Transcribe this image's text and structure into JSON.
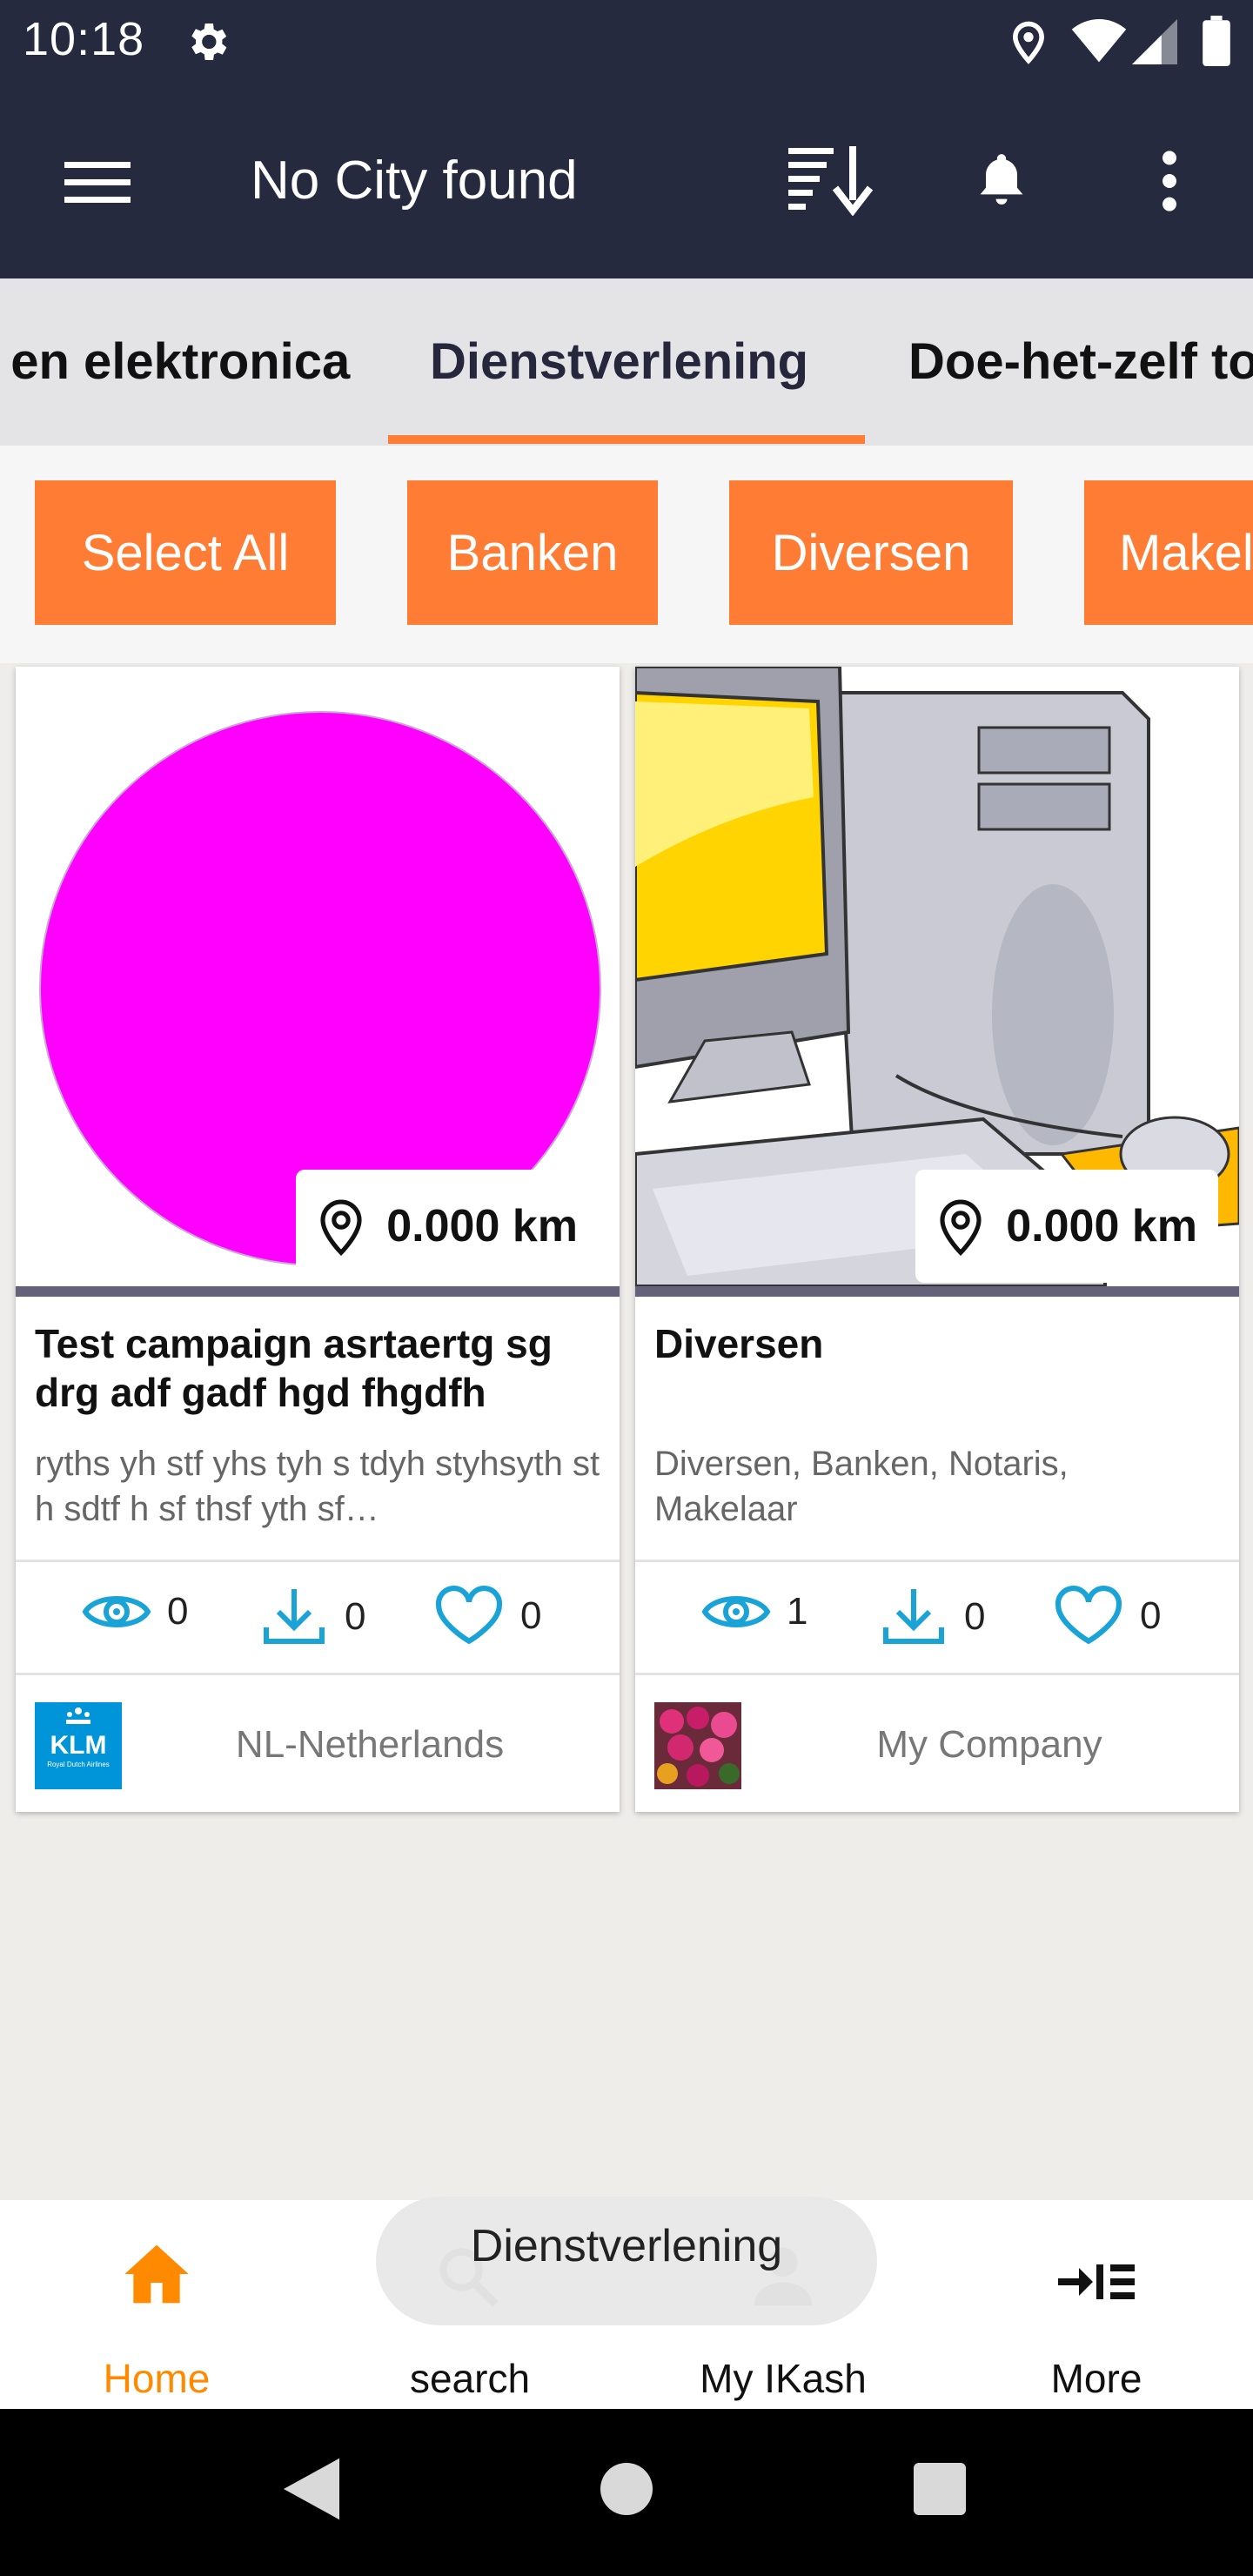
{
  "status_bar": {
    "time": "10:18"
  },
  "toolbar": {
    "title": "No City found"
  },
  "tabs": [
    {
      "label": "Computers en elektronica",
      "active": false
    },
    {
      "label": "Dienstverlening",
      "active": true
    },
    {
      "label": "Doe-het-zelf tools",
      "active": false
    }
  ],
  "chips": [
    "Select All",
    "Banken",
    "Diversen",
    "Makelaar"
  ],
  "cards": [
    {
      "distance": "0.000 km",
      "title": "Test campaign asrtaertg sg drg adf gadf hgd fhgdfh",
      "description": "ryths yh stf yhs tyh s tdyh styhsyth st h sdtf h sf thsf yth sf…",
      "views": "0",
      "downloads": "0",
      "likes": "0",
      "company": "NL-Netherlands",
      "logo_text": "KLM",
      "logo_subtext": "Royal Dutch Airlines"
    },
    {
      "distance": "0.000 km",
      "title": "Diversen",
      "description": "Diversen, Banken, Notaris, Makelaar",
      "views": "1",
      "downloads": "0",
      "likes": "0",
      "company": "My Company"
    }
  ],
  "bottom_nav": [
    {
      "label": "Home",
      "icon": "home-icon",
      "active": true
    },
    {
      "label": "search",
      "icon": "search-icon",
      "active": false
    },
    {
      "label": "My IKash",
      "icon": "person-icon",
      "active": false
    },
    {
      "label": "More",
      "icon": "more-list-icon",
      "active": false
    }
  ],
  "toast": "Dienstverlening",
  "colors": {
    "dark": "#262a3f",
    "accent": "#ff7c35",
    "icon_blue": "#1aa3d6"
  }
}
